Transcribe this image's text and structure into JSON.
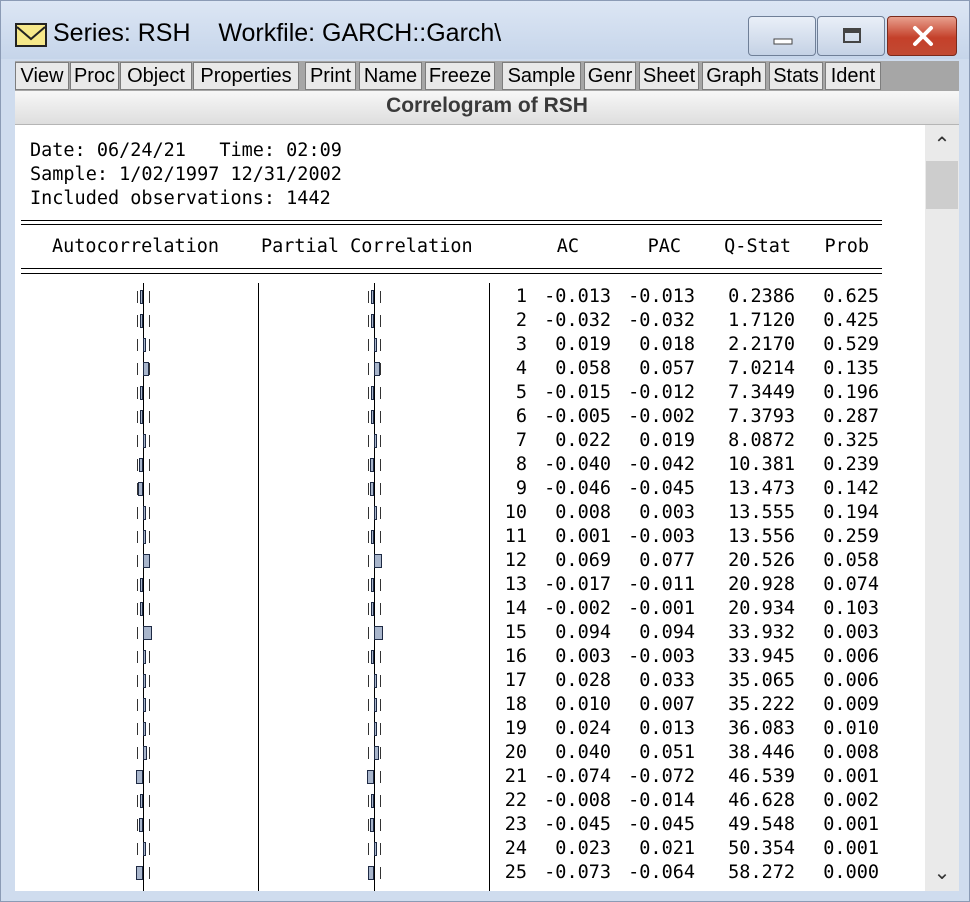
{
  "window": {
    "title": "Series: RSH    Workfile: GARCH::Garch\\",
    "controls": {
      "minimize_icon": "minimize-icon",
      "maximize_icon": "maximize-icon",
      "close_icon": "close-icon"
    }
  },
  "toolbar": {
    "buttons": [
      "View",
      "Proc",
      "Object",
      "Properties",
      "Print",
      "Name",
      "Freeze",
      "Sample",
      "Genr",
      "Sheet",
      "Graph",
      "Stats",
      "Ident"
    ]
  },
  "view_title": "Correlogram of RSH",
  "info": {
    "line1": "Date: 06/24/21   Time: 02:09",
    "line2": "Sample: 1/02/1997 12/31/2002",
    "line3": "Included observations: 1442"
  },
  "columns": {
    "autocorrelation": "Autocorrelation",
    "partial_correlation": "Partial Correlation",
    "ac": "AC",
    "pac": "PAC",
    "qstat": "Q-Stat",
    "prob": "Prob"
  },
  "rows": [
    {
      "lag": "1",
      "ac": "-0.013",
      "pac": "-0.013",
      "q": "0.2386",
      "prob": "0.625"
    },
    {
      "lag": "2",
      "ac": "-0.032",
      "pac": "-0.032",
      "q": "1.7120",
      "prob": "0.425"
    },
    {
      "lag": "3",
      "ac": "0.019",
      "pac": "0.018",
      "q": "2.2170",
      "prob": "0.529"
    },
    {
      "lag": "4",
      "ac": "0.058",
      "pac": "0.057",
      "q": "7.0214",
      "prob": "0.135"
    },
    {
      "lag": "5",
      "ac": "-0.015",
      "pac": "-0.012",
      "q": "7.3449",
      "prob": "0.196"
    },
    {
      "lag": "6",
      "ac": "-0.005",
      "pac": "-0.002",
      "q": "7.3793",
      "prob": "0.287"
    },
    {
      "lag": "7",
      "ac": "0.022",
      "pac": "0.019",
      "q": "8.0872",
      "prob": "0.325"
    },
    {
      "lag": "8",
      "ac": "-0.040",
      "pac": "-0.042",
      "q": "10.381",
      "prob": "0.239"
    },
    {
      "lag": "9",
      "ac": "-0.046",
      "pac": "-0.045",
      "q": "13.473",
      "prob": "0.142"
    },
    {
      "lag": "10",
      "ac": "0.008",
      "pac": "0.003",
      "q": "13.555",
      "prob": "0.194"
    },
    {
      "lag": "11",
      "ac": "0.001",
      "pac": "-0.003",
      "q": "13.556",
      "prob": "0.259"
    },
    {
      "lag": "12",
      "ac": "0.069",
      "pac": "0.077",
      "q": "20.526",
      "prob": "0.058"
    },
    {
      "lag": "13",
      "ac": "-0.017",
      "pac": "-0.011",
      "q": "20.928",
      "prob": "0.074"
    },
    {
      "lag": "14",
      "ac": "-0.002",
      "pac": "-0.001",
      "q": "20.934",
      "prob": "0.103"
    },
    {
      "lag": "15",
      "ac": "0.094",
      "pac": "0.094",
      "q": "33.932",
      "prob": "0.003"
    },
    {
      "lag": "16",
      "ac": "0.003",
      "pac": "-0.003",
      "q": "33.945",
      "prob": "0.006"
    },
    {
      "lag": "17",
      "ac": "0.028",
      "pac": "0.033",
      "q": "35.065",
      "prob": "0.006"
    },
    {
      "lag": "18",
      "ac": "0.010",
      "pac": "0.007",
      "q": "35.222",
      "prob": "0.009"
    },
    {
      "lag": "19",
      "ac": "0.024",
      "pac": "0.013",
      "q": "36.083",
      "prob": "0.010"
    },
    {
      "lag": "20",
      "ac": "0.040",
      "pac": "0.051",
      "q": "38.446",
      "prob": "0.008"
    },
    {
      "lag": "21",
      "ac": "-0.074",
      "pac": "-0.072",
      "q": "46.539",
      "prob": "0.001"
    },
    {
      "lag": "22",
      "ac": "-0.008",
      "pac": "-0.014",
      "q": "46.628",
      "prob": "0.002"
    },
    {
      "lag": "23",
      "ac": "-0.045",
      "pac": "-0.045",
      "q": "49.548",
      "prob": "0.001"
    },
    {
      "lag": "24",
      "ac": "0.023",
      "pac": "0.021",
      "q": "50.354",
      "prob": "0.001"
    },
    {
      "lag": "25",
      "ac": "-0.073",
      "pac": "-0.064",
      "q": "58.272",
      "prob": "0.000"
    }
  ],
  "colors": {
    "bar_fill": "#a9b6cc",
    "close_button": "#c4402a"
  },
  "scrollbar": {
    "up_icon": "chevron-up-icon",
    "down_icon": "chevron-down-icon"
  }
}
